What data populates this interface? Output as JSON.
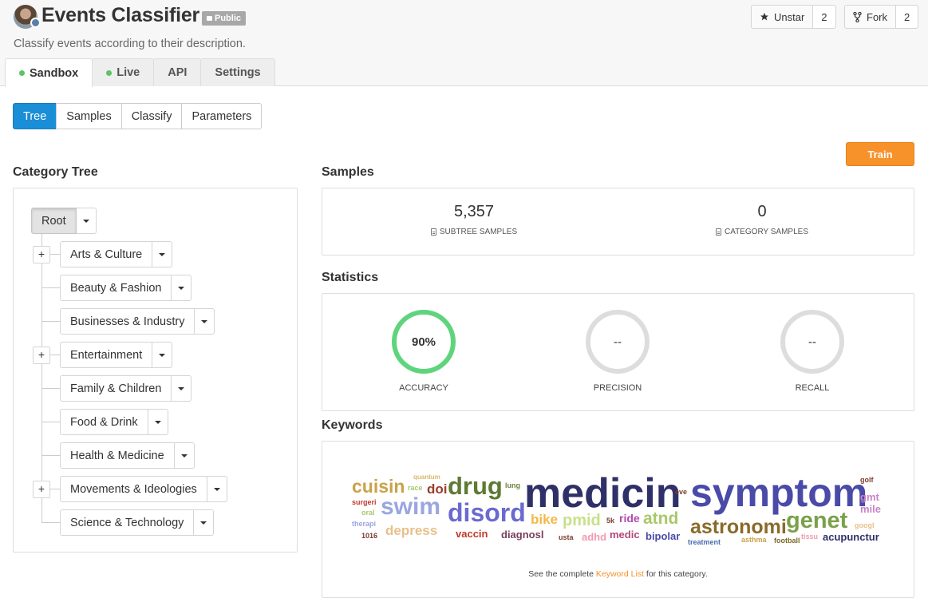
{
  "header": {
    "title": "Events Classifier",
    "badge": "Public",
    "description": "Classify events according to their description.",
    "unstar_label": "Unstar",
    "unstar_count": "2",
    "fork_label": "Fork",
    "fork_count": "2"
  },
  "main_tabs": [
    "Sandbox",
    "Live",
    "API",
    "Settings"
  ],
  "sub_tabs": [
    "Tree",
    "Samples",
    "Classify",
    "Parameters"
  ],
  "train_label": "Train",
  "category_tree": {
    "title": "Category Tree",
    "root": "Root",
    "children": [
      "Arts & Culture",
      "Beauty & Fashion",
      "Businesses & Industry",
      "Entertainment",
      "Family & Children",
      "Food & Drink",
      "Health & Medicine",
      "Movements & Ideologies",
      "Science & Technology"
    ]
  },
  "samples": {
    "title": "Samples",
    "subtree_value": "5,357",
    "subtree_label": "SUBTREE SAMPLES",
    "category_value": "0",
    "category_label": "CATEGORY SAMPLES"
  },
  "statistics": {
    "title": "Statistics",
    "accuracy_value": "90%",
    "accuracy_fraction": 0.9,
    "accuracy_label": "ACCURACY",
    "precision_value": "--",
    "precision_label": "PRECISION",
    "recall_value": "--",
    "recall_label": "RECALL"
  },
  "keywords": {
    "title": "Keywords",
    "note_before": "See the complete ",
    "note_link": "Keyword List",
    "note_after": " for this category.",
    "words": [
      "cuisin",
      "quantum",
      "race",
      "doi",
      "drug",
      "lung",
      "medicin",
      "eve",
      "symptom",
      "golf",
      "surgeri",
      "swim",
      "disord",
      "gmt",
      "mile",
      "oral",
      "therapi",
      "depress",
      "bike",
      "pmid",
      "5k",
      "ride",
      "atnd",
      "astronomi",
      "genet",
      "googl",
      "1016",
      "vaccin",
      "diagnosl",
      "usta",
      "adhd",
      "medic",
      "bipolar",
      "treatment",
      "asthma",
      "football",
      "tissu",
      "acupunctur"
    ]
  },
  "colors": {
    "accent_blue": "#1a8ed6",
    "train_orange": "#f7922a",
    "accuracy_green": "#5fd47d",
    "live_dot": "#5cc466"
  }
}
